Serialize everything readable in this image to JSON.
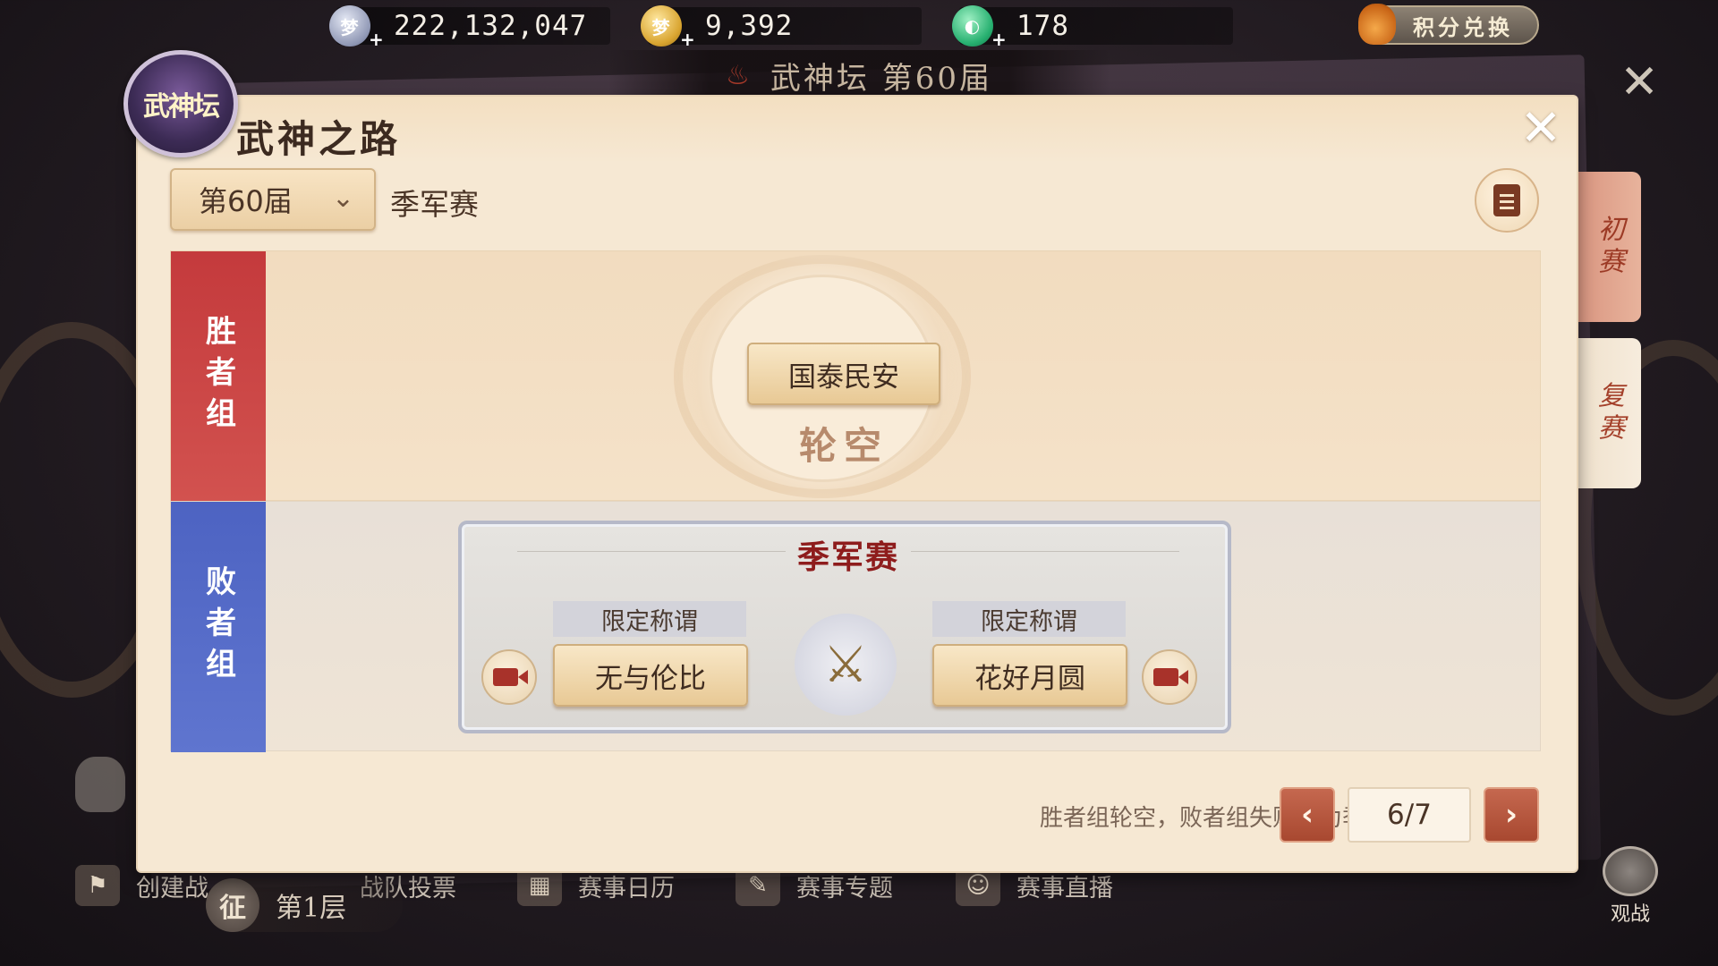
{
  "currencies": {
    "silver": {
      "value": "222,132,047",
      "icon": "silver-coin-icon",
      "color": "#8f97b4"
    },
    "gold": {
      "value": "9,392",
      "icon": "gold-coin-icon",
      "color": "#d9a531"
    },
    "jade": {
      "value": "178",
      "icon": "jade-icon",
      "color": "#27b070"
    },
    "plus": "+"
  },
  "exchange": {
    "label": "积分兑换"
  },
  "background": {
    "season_banner": "武神坛 第60届",
    "close": "✕",
    "bottom_nav": [
      {
        "label": "创建战",
        "icon": "create-team-icon"
      },
      {
        "label": "战队投票",
        "icon": "vote-icon"
      },
      {
        "label": "赛事日历",
        "icon": "calendar-icon"
      },
      {
        "label": "赛事专题",
        "icon": "topic-icon"
      },
      {
        "label": "赛事直播",
        "icon": "live-icon"
      }
    ],
    "floor": {
      "badge": "征",
      "label": "第1层"
    },
    "watch": "观战"
  },
  "side_tabs": {
    "prelim": "初赛",
    "repechage": "复赛"
  },
  "panel": {
    "title": "武神之路",
    "logo_text": "武神坛",
    "close": "✕",
    "season_select": {
      "value": "第60届",
      "chevron": "⌄"
    },
    "stage": "季军赛"
  },
  "bracket": {
    "winners_label": "胜者组",
    "losers_label": "败者组",
    "winner_team": "国泰民安",
    "winner_status": "轮空",
    "match": {
      "title": "季军赛",
      "left": {
        "tag": "限定称谓",
        "team": "无与伦比"
      },
      "right": {
        "tag": "限定称谓",
        "team": "花好月圆"
      },
      "vs_icon": "crossed-swords-icon"
    }
  },
  "footer": {
    "note": "胜者组轮空，败者组失败队为季军",
    "page": "6/7",
    "prev": "‹",
    "next": "›"
  }
}
